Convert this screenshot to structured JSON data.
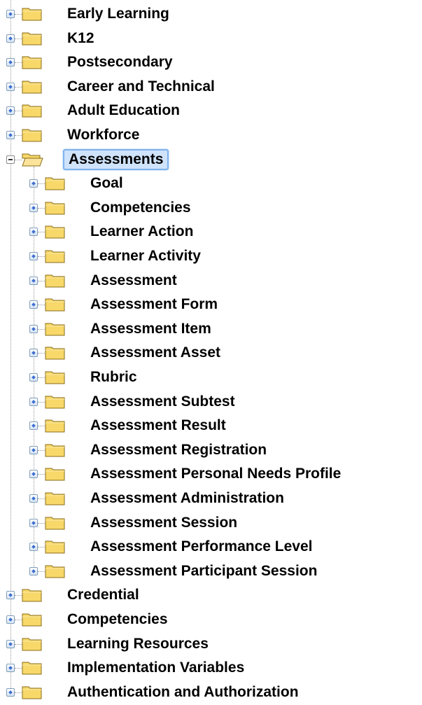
{
  "colors": {
    "selection_fill": "#cfe3fb",
    "selection_border": "#7fb2ec",
    "folder_fill": "#f7d869",
    "expander_accent": "#3e6fcf"
  },
  "icons": {
    "collapsed_expander": "plus-expander-icon",
    "expanded_expander": "minus-expander-icon",
    "closed_folder": "folder-icon",
    "open_folder": "folder-open-icon"
  },
  "tree": {
    "items": [
      {
        "label": "Early Learning",
        "level": 0,
        "expanded": false
      },
      {
        "label": "K12",
        "level": 0,
        "expanded": false
      },
      {
        "label": "Postsecondary",
        "level": 0,
        "expanded": false
      },
      {
        "label": "Career and Technical",
        "level": 0,
        "expanded": false
      },
      {
        "label": "Adult Education",
        "level": 0,
        "expanded": false
      },
      {
        "label": "Workforce",
        "level": 0,
        "expanded": false
      },
      {
        "label": "Assessments",
        "level": 0,
        "expanded": true,
        "selected": true
      },
      {
        "label": "Goal",
        "level": 1,
        "expanded": false
      },
      {
        "label": "Competencies",
        "level": 1,
        "expanded": false
      },
      {
        "label": "Learner Action",
        "level": 1,
        "expanded": false
      },
      {
        "label": "Learner Activity",
        "level": 1,
        "expanded": false
      },
      {
        "label": "Assessment",
        "level": 1,
        "expanded": false
      },
      {
        "label": "Assessment Form",
        "level": 1,
        "expanded": false
      },
      {
        "label": "Assessment Item",
        "level": 1,
        "expanded": false
      },
      {
        "label": "Assessment Asset",
        "level": 1,
        "expanded": false
      },
      {
        "label": "Rubric",
        "level": 1,
        "expanded": false
      },
      {
        "label": "Assessment Subtest",
        "level": 1,
        "expanded": false
      },
      {
        "label": "Assessment Result",
        "level": 1,
        "expanded": false
      },
      {
        "label": "Assessment Registration",
        "level": 1,
        "expanded": false
      },
      {
        "label": "Assessment Personal Needs Profile",
        "level": 1,
        "expanded": false
      },
      {
        "label": "Assessment Administration",
        "level": 1,
        "expanded": false
      },
      {
        "label": "Assessment Session",
        "level": 1,
        "expanded": false
      },
      {
        "label": "Assessment Performance Level",
        "level": 1,
        "expanded": false
      },
      {
        "label": "Assessment Participant Session",
        "level": 1,
        "expanded": false
      },
      {
        "label": "Credential",
        "level": 0,
        "expanded": false
      },
      {
        "label": "Competencies",
        "level": 0,
        "expanded": false
      },
      {
        "label": "Learning Resources",
        "level": 0,
        "expanded": false
      },
      {
        "label": "Implementation Variables",
        "level": 0,
        "expanded": false
      },
      {
        "label": "Authentication and Authorization",
        "level": 0,
        "expanded": false
      }
    ]
  }
}
